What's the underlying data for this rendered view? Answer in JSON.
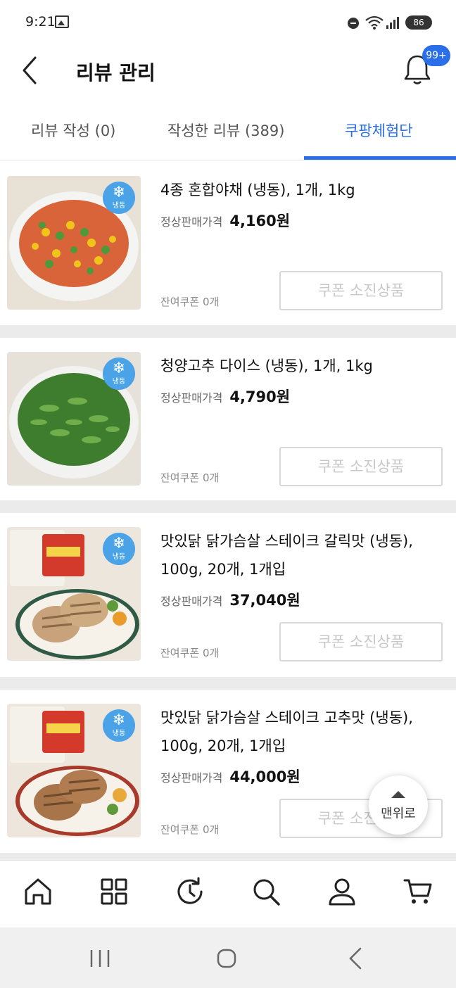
{
  "status_bar": {
    "time": "9:21",
    "battery": "86"
  },
  "header": {
    "title": "리뷰 관리",
    "notification_badge": "99+"
  },
  "tabs": [
    {
      "label": "리뷰 작성 (0)"
    },
    {
      "label": "작성한 리뷰 (389)"
    },
    {
      "label": "쿠팡체험단"
    }
  ],
  "price_label": "정상판매가격",
  "products": [
    {
      "name": "4종 혼합야채 (냉동), 1개, 1kg",
      "price": "4,160원",
      "remaining": "잔여쿠폰 0개",
      "button": "쿠폰 소진상품",
      "frozen_label": "냉동"
    },
    {
      "name": "청양고추 다이스 (냉동), 1개, 1kg",
      "price": "4,790원",
      "remaining": "잔여쿠폰 0개",
      "button": "쿠폰 소진상품",
      "frozen_label": "냉동"
    },
    {
      "name": "맛있닭 닭가슴살 스테이크 갈릭맛 (냉동), 100g, 20개, 1개입",
      "price": "37,040원",
      "remaining": "잔여쿠폰 0개",
      "button": "쿠폰 소진상품",
      "frozen_label": "냉동"
    },
    {
      "name": "맛있닭 닭가슴살 스테이크 고추맛 (냉동), 100g, 20개, 1개입",
      "price": "44,000원",
      "remaining": "잔여쿠폰 0개",
      "button": "쿠폰 소진상품",
      "frozen_label": "냉동"
    }
  ],
  "scroll_top": {
    "label": "맨위로"
  },
  "bottom_nav": [
    "home-icon",
    "category-grid-icon",
    "recent-history-icon",
    "search-icon",
    "my-account-icon",
    "cart-icon"
  ],
  "colors": {
    "accent": "#2a6ee8",
    "frozen_badge": "#4aa3e6",
    "disabled_text": "#c8c8c8"
  }
}
